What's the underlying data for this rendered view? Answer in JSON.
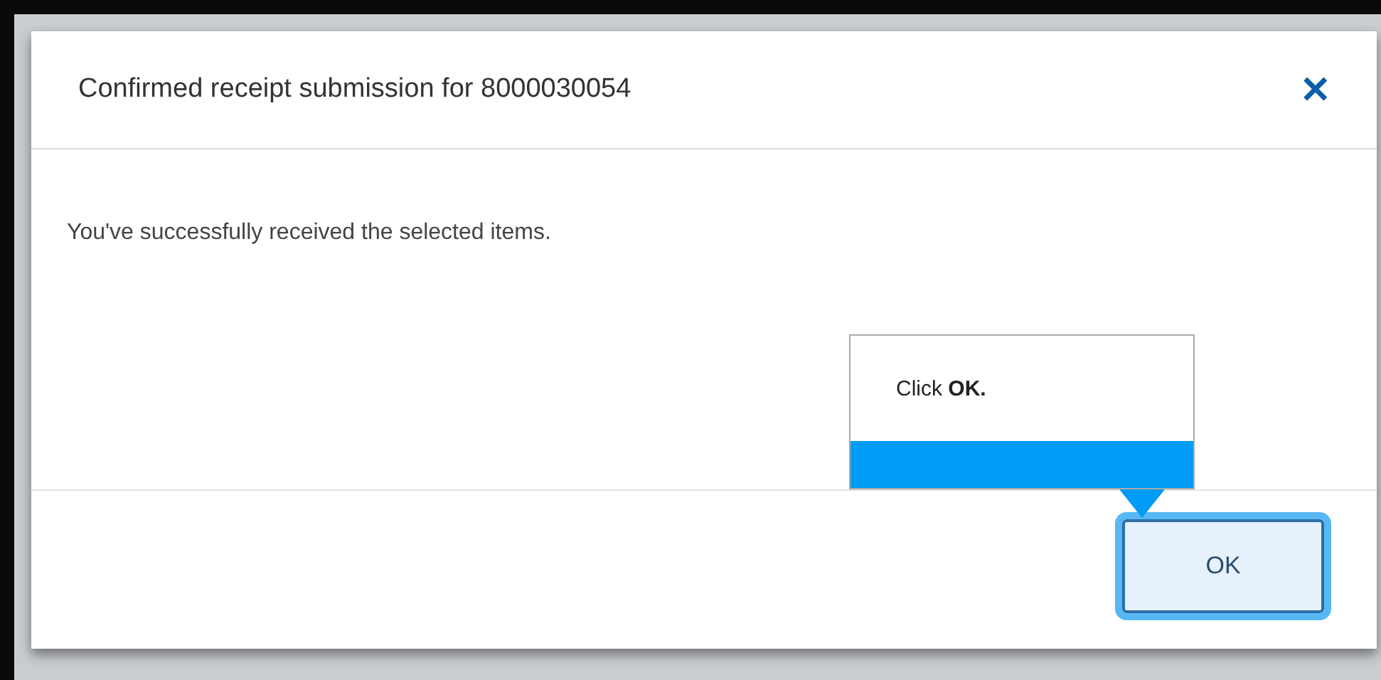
{
  "dialog": {
    "title": "Confirmed receipt submission for 8000030054",
    "message": "You've successfully received the selected items.",
    "close_glyph": "✕",
    "buttons": [
      {
        "label": "OK",
        "focused": true
      }
    ]
  },
  "tooltip": {
    "text": "Click **OK.**"
  }
}
